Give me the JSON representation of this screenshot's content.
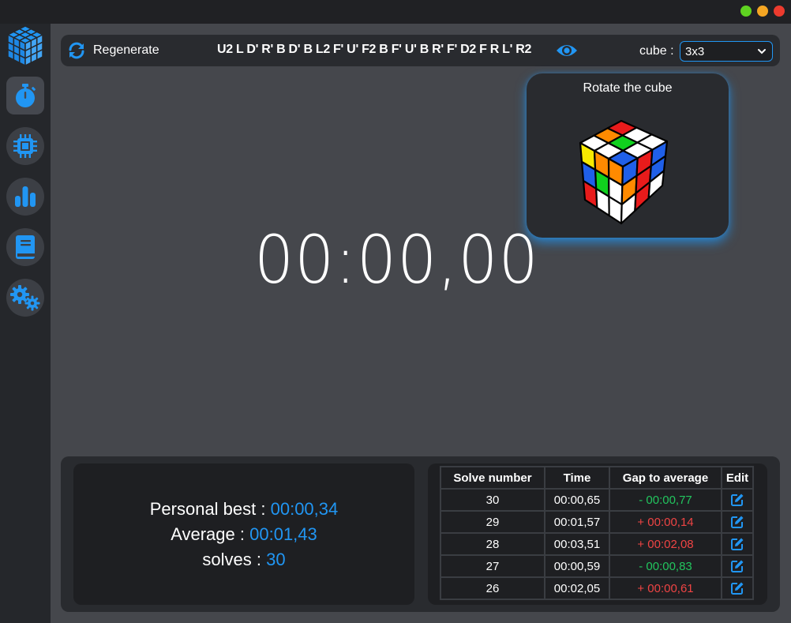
{
  "window": {
    "dot_colors": [
      "#5fd321",
      "#f5a623",
      "#ec3b2e"
    ]
  },
  "sidebar": {
    "items": [
      {
        "icon": "stopwatch-icon",
        "active": true
      },
      {
        "icon": "chip-icon",
        "active": false
      },
      {
        "icon": "bar-chart-icon",
        "active": false
      },
      {
        "icon": "book-icon",
        "active": false
      },
      {
        "icon": "gears-icon",
        "active": false
      }
    ]
  },
  "topbar": {
    "regenerate_label": "Regenerate",
    "scramble": "U2 L D' R' B D' B L2 F' U' F2 B F' U' B R' F' D2 F R L' R2",
    "cube_label": "cube :",
    "cube_selected": "3x3"
  },
  "cube_panel": {
    "title": "Rotate the cube"
  },
  "timer": {
    "display": "00:00,00"
  },
  "stats": {
    "pb_label": "Personal best :",
    "pb_value": "00:00,34",
    "avg_label": "Average :",
    "avg_value": "00:01,43",
    "solves_label": "solves :",
    "solves_value": "30"
  },
  "solves_table": {
    "headers": [
      "Solve number",
      "Time",
      "Gap to average",
      "Edit"
    ],
    "rows": [
      {
        "number": "30",
        "time": "00:00,65",
        "gap": "- 00:00,77",
        "sign": "neg"
      },
      {
        "number": "29",
        "time": "00:01,57",
        "gap": "+ 00:00,14",
        "sign": "pos"
      },
      {
        "number": "28",
        "time": "00:03,51",
        "gap": "+ 00:02,08",
        "sign": "pos"
      },
      {
        "number": "27",
        "time": "00:00,59",
        "gap": "- 00:00,83",
        "sign": "neg"
      },
      {
        "number": "26",
        "time": "00:02,05",
        "gap": "+ 00:00,61",
        "sign": "pos"
      }
    ]
  },
  "colors": {
    "accent": "#2196f3",
    "negative_gap": "#22c55e",
    "positive_gap": "#ef4444"
  }
}
